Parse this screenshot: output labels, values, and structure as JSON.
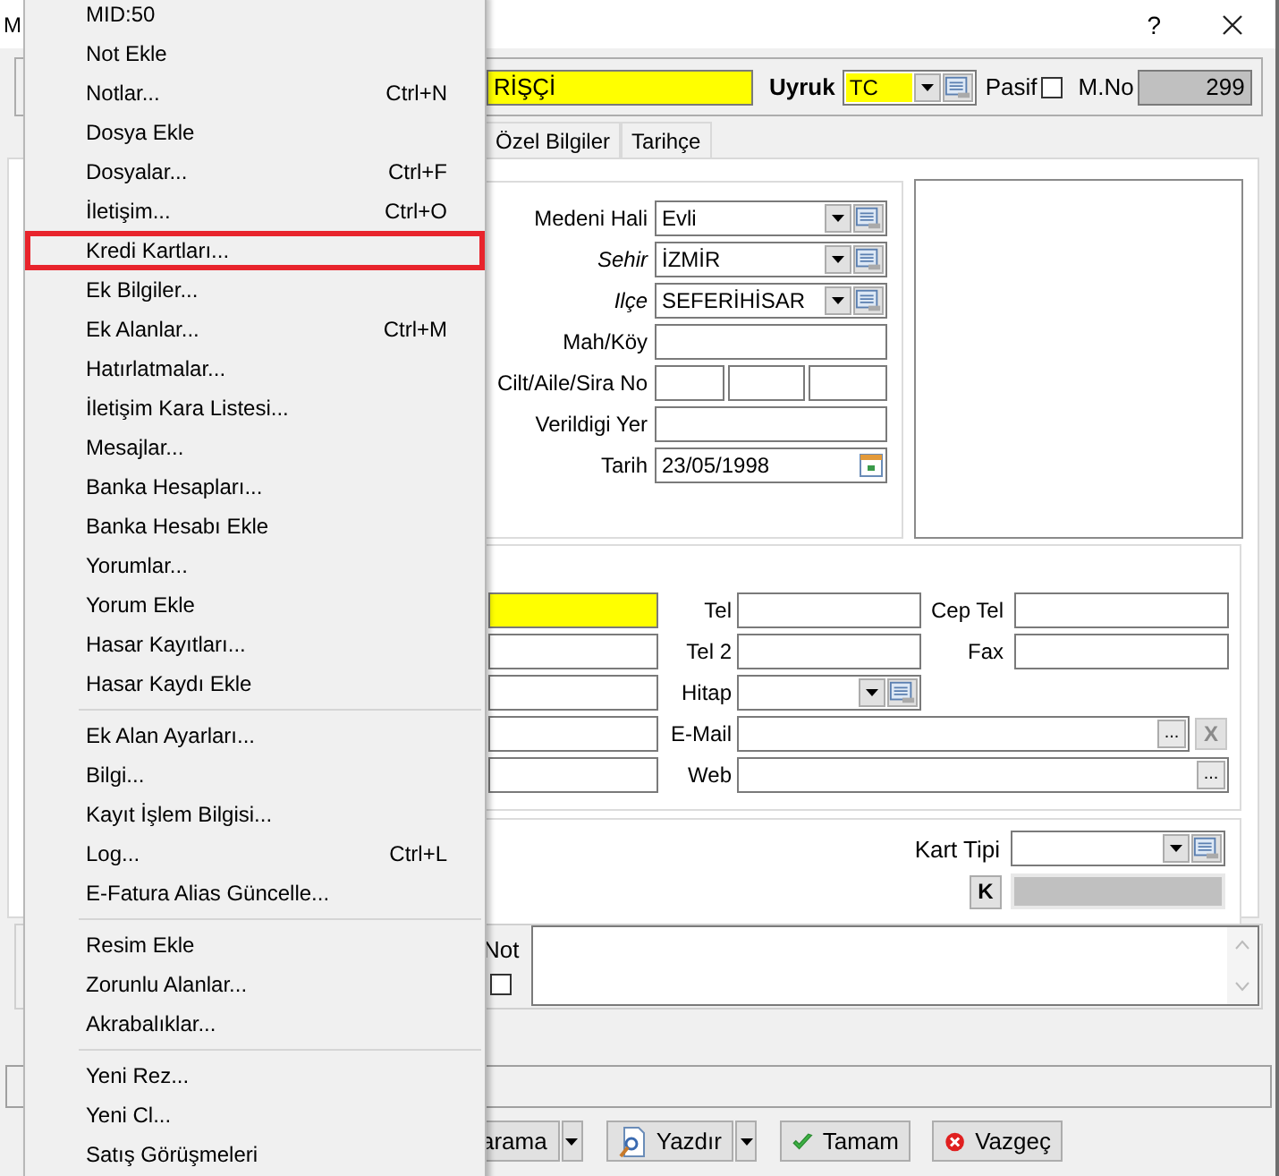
{
  "window": {
    "title": "M",
    "help": "?"
  },
  "header": {
    "name": {
      "value": "RİŞÇİ",
      "required": true
    },
    "nationality": {
      "label": "Uyruk",
      "value": "TC",
      "required": true
    },
    "passive": {
      "label": "Pasif",
      "checked": false
    },
    "member_no": {
      "label": "M.No",
      "value": "299"
    }
  },
  "tabs": [
    {
      "label": "Özel Bilgiler",
      "selected": false
    },
    {
      "label": "Tarihçe",
      "selected": false
    }
  ],
  "personal_fields": [
    {
      "kind": "combo",
      "label": "Medeni Hali",
      "italic": false,
      "value": "Evli"
    },
    {
      "kind": "combo",
      "label": "Sehir",
      "italic": true,
      "value": "İZMİR"
    },
    {
      "kind": "combo",
      "label": "Ilçe",
      "italic": true,
      "value": "SEFERİHİSAR"
    },
    {
      "kind": "text",
      "label": "Mah/Köy",
      "italic": false
    },
    {
      "kind": "triple",
      "label": "Cilt/Aile/Sira No",
      "italic": false
    },
    {
      "kind": "text",
      "label": "Verildigi Yer",
      "italic": false
    },
    {
      "kind": "date",
      "label": "Tarih",
      "italic": false,
      "value": "23/05/1998"
    }
  ],
  "contact_rows": [
    {
      "left_required": true,
      "label": "Tel",
      "kind": "pair",
      "second_label": "Cep Tel"
    },
    {
      "left_required": false,
      "label": "Tel 2",
      "kind": "pair",
      "second_label": "Fax"
    },
    {
      "left_required": false,
      "label": "Hitap",
      "kind": "combo"
    },
    {
      "left_required": false,
      "label": "E-Mail",
      "kind": "email",
      "browse_label": "...",
      "clear_label": "X",
      "clear_disabled": true
    },
    {
      "left_required": false,
      "label": "Web",
      "kind": "web",
      "browse_label": "..."
    }
  ],
  "card": {
    "type_label": "Kart Tipi",
    "k_label": "K"
  },
  "note": {
    "label": "Not",
    "checked": false
  },
  "buttons": [
    {
      "label": "arama",
      "kind": "search"
    },
    {
      "label": "Yazdır",
      "kind": "print"
    },
    {
      "label": "Tamam",
      "kind": "ok"
    },
    {
      "label": "Vazgeç",
      "kind": "cancel"
    }
  ],
  "menu": [
    {
      "kind": "item",
      "label": "MID:50",
      "highlighted": false
    },
    {
      "kind": "item",
      "label": "Not Ekle",
      "highlighted": false
    },
    {
      "kind": "item",
      "label": "Notlar...",
      "shortcut": "Ctrl+N",
      "highlighted": false
    },
    {
      "kind": "item",
      "label": "Dosya Ekle",
      "highlighted": false
    },
    {
      "kind": "item",
      "label": "Dosyalar...",
      "shortcut": "Ctrl+F",
      "highlighted": false
    },
    {
      "kind": "item",
      "label": "İletişim...",
      "shortcut": "Ctrl+O",
      "highlighted": false
    },
    {
      "kind": "item",
      "label": "Kredi Kartları...",
      "highlighted": true
    },
    {
      "kind": "item",
      "label": "Ek Bilgiler...",
      "highlighted": false
    },
    {
      "kind": "item",
      "label": "Ek Alanlar...",
      "shortcut": "Ctrl+M",
      "highlighted": false
    },
    {
      "kind": "item",
      "label": "Hatırlatmalar...",
      "highlighted": false
    },
    {
      "kind": "item",
      "label": "İletişim Kara Listesi...",
      "highlighted": false
    },
    {
      "kind": "item",
      "label": "Mesajlar...",
      "highlighted": false
    },
    {
      "kind": "item",
      "label": "Banka Hesapları...",
      "highlighted": false
    },
    {
      "kind": "item",
      "label": "Banka Hesabı Ekle",
      "highlighted": false
    },
    {
      "kind": "item",
      "label": "Yorumlar...",
      "highlighted": false
    },
    {
      "kind": "item",
      "label": "Yorum Ekle",
      "highlighted": false
    },
    {
      "kind": "item",
      "label": "Hasar Kayıtları...",
      "highlighted": false
    },
    {
      "kind": "item",
      "label": "Hasar Kaydı Ekle",
      "highlighted": false
    },
    {
      "kind": "separator"
    },
    {
      "kind": "item",
      "label": "Ek Alan Ayarları...",
      "highlighted": false
    },
    {
      "kind": "item",
      "label": "Bilgi...",
      "highlighted": false
    },
    {
      "kind": "item",
      "label": "Kayıt İşlem Bilgisi...",
      "highlighted": false
    },
    {
      "kind": "item",
      "label": "Log...",
      "shortcut": "Ctrl+L",
      "highlighted": false
    },
    {
      "kind": "item",
      "label": "E-Fatura Alias Güncelle...",
      "highlighted": false
    },
    {
      "kind": "separator"
    },
    {
      "kind": "item",
      "label": "Resim Ekle",
      "highlighted": false
    },
    {
      "kind": "item",
      "label": "Zorunlu Alanlar...",
      "highlighted": false
    },
    {
      "kind": "item",
      "label": "Akrabalıklar...",
      "highlighted": false
    },
    {
      "kind": "separator"
    },
    {
      "kind": "item",
      "label": "Yeni Rez...",
      "highlighted": false
    },
    {
      "kind": "item",
      "label": "Yeni Cl...",
      "highlighted": false
    },
    {
      "kind": "item",
      "label": "Satış Görüşmeleri",
      "highlighted": false
    }
  ]
}
